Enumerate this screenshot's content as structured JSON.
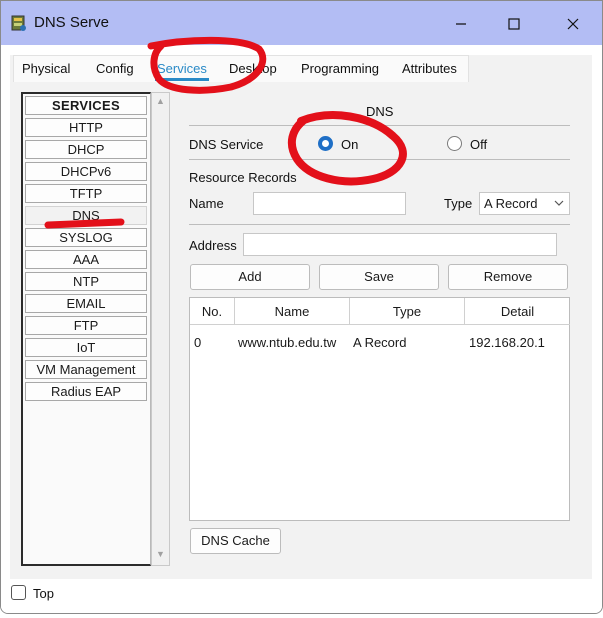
{
  "window": {
    "title": "DNS Serve"
  },
  "tabs": [
    {
      "label": "Physical"
    },
    {
      "label": "Config"
    },
    {
      "label": "Services"
    },
    {
      "label": "Desktop"
    },
    {
      "label": "Programming"
    },
    {
      "label": "Attributes"
    }
  ],
  "services_panel": {
    "header": "SERVICES",
    "items": [
      "HTTP",
      "DHCP",
      "DHCPv6",
      "TFTP",
      "DNS",
      "SYSLOG",
      "AAA",
      "NTP",
      "EMAIL",
      "FTP",
      "IoT",
      "VM Management",
      "Radius EAP"
    ]
  },
  "dns": {
    "section_title": "DNS",
    "service_label": "DNS Service",
    "on_label": "On",
    "off_label": "Off",
    "selected": "On",
    "resource_records_label": "Resource Records",
    "name_label": "Name",
    "name_value": "",
    "type_label": "Type",
    "type_value": "A Record",
    "address_label": "Address",
    "address_value": "",
    "add_button": "Add",
    "save_button": "Save",
    "remove_button": "Remove",
    "table": {
      "columns": [
        "No.",
        "Name",
        "Type",
        "Detail"
      ],
      "rows": [
        [
          "0",
          "www.ntub.edu.tw",
          "A Record",
          "192.168.20.1"
        ]
      ]
    },
    "cache_button": "DNS Cache"
  },
  "footer": {
    "top_label": "Top"
  },
  "colors": {
    "titlebar": "#b3bdf4",
    "accent": "#2a8ac7",
    "annotation": "#e3101a"
  }
}
